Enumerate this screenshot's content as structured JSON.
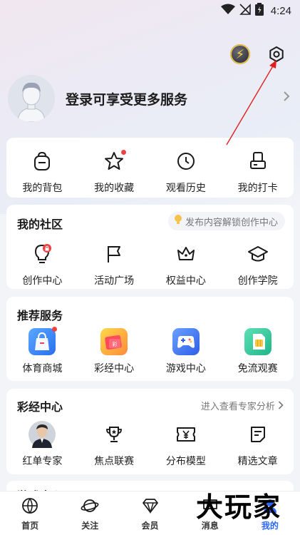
{
  "status_bar": {
    "time": "4:24"
  },
  "profile": {
    "login_text": "登录可享受更多服务"
  },
  "quick_actions": [
    {
      "label": "我的背包",
      "icon": "backpack-icon",
      "badge": false
    },
    {
      "label": "我的收藏",
      "icon": "star-icon",
      "badge": true
    },
    {
      "label": "观看历史",
      "icon": "clock-icon",
      "badge": false
    },
    {
      "label": "我的打卡",
      "icon": "stamp-icon",
      "badge": false
    }
  ],
  "community": {
    "title": "我的社区",
    "tip": "发布内容解锁创作中心",
    "items": [
      {
        "label": "创作中心",
        "icon": "lightbulb-lock-icon"
      },
      {
        "label": "活动广场",
        "icon": "flag-icon"
      },
      {
        "label": "权益中心",
        "icon": "crown-icon"
      },
      {
        "label": "创作学院",
        "icon": "graduation-cap-icon"
      }
    ]
  },
  "recommended": {
    "title": "推荐服务",
    "items": [
      {
        "label": "体育商城",
        "icon": "shopping-bag-icon",
        "color": "#3a8df5",
        "badge": true
      },
      {
        "label": "彩经中心",
        "icon": "lottery-ticket-icon",
        "color": "#ff6b5a",
        "badge": false
      },
      {
        "label": "游戏中心",
        "icon": "gamepad-icon",
        "color": "#3e7bff",
        "badge": false
      },
      {
        "label": "免流观赛",
        "icon": "sim-card-icon",
        "color": "#37c9a0",
        "badge": false
      }
    ]
  },
  "lottery": {
    "title": "彩经中心",
    "link": "进入查看专家分析",
    "items": [
      {
        "label": "红单专家",
        "icon": "expert-avatar-icon"
      },
      {
        "label": "焦点联赛",
        "icon": "trophy-icon"
      },
      {
        "label": "分布模型",
        "icon": "yen-ticket-icon"
      },
      {
        "label": "精选文章",
        "icon": "article-icon"
      }
    ]
  },
  "partial_section": {
    "title": "游戏中心"
  },
  "tabbar": [
    {
      "label": "首页",
      "icon": "basketball-icon",
      "active": false
    },
    {
      "label": "关注",
      "icon": "planet-icon",
      "active": false
    },
    {
      "label": "会员",
      "icon": "diamond-icon",
      "active": false
    },
    {
      "label": "消息",
      "icon": "message-icon",
      "active": false
    },
    {
      "label": "我的",
      "icon": "profile-icon",
      "active": true
    }
  ],
  "watermark": "大玩家",
  "colors": {
    "accent": "#2a66ff",
    "badge_red": "#f04040",
    "annotation_red": "#e02020"
  }
}
